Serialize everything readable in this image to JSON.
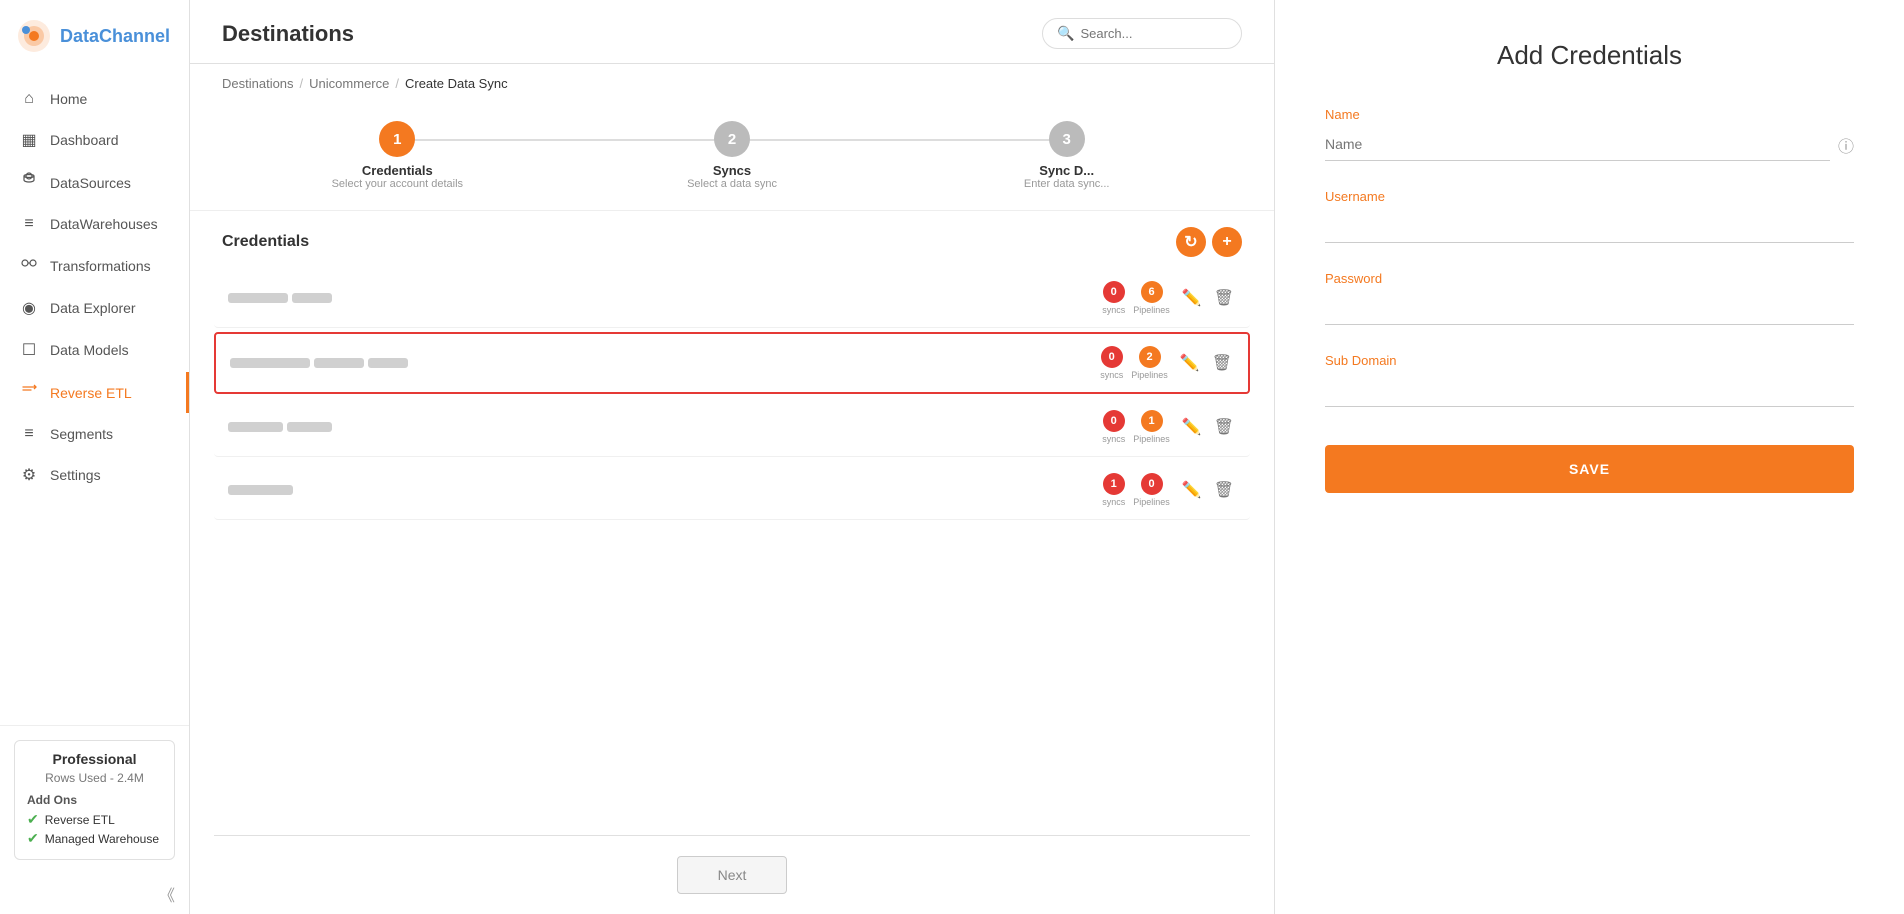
{
  "app": {
    "logo_data": "DC",
    "logo_brand": "DataChannel"
  },
  "sidebar": {
    "items": [
      {
        "id": "home",
        "label": "Home",
        "icon": "⌂",
        "active": false
      },
      {
        "id": "dashboard",
        "label": "Dashboard",
        "icon": "▦",
        "active": false
      },
      {
        "id": "datasources",
        "label": "DataSources",
        "icon": "⋯",
        "active": false
      },
      {
        "id": "datawarehouses",
        "label": "DataWarehouses",
        "icon": "≡",
        "active": false
      },
      {
        "id": "transformations",
        "label": "Transformations",
        "icon": "⟳",
        "active": false
      },
      {
        "id": "data-explorer",
        "label": "Data Explorer",
        "icon": "◉",
        "active": false
      },
      {
        "id": "data-models",
        "label": "Data Models",
        "icon": "☐",
        "active": false
      },
      {
        "id": "reverse-etl",
        "label": "Reverse ETL",
        "icon": "⇄",
        "active": true
      },
      {
        "id": "segments",
        "label": "Segments",
        "icon": "≡",
        "active": false
      },
      {
        "id": "settings",
        "label": "Settings",
        "icon": "⚙",
        "active": false
      }
    ]
  },
  "plan": {
    "name": "Professional",
    "rows_label": "Rows Used - 2.4M",
    "addons_title": "Add Ons",
    "addons": [
      {
        "label": "Reverse ETL"
      },
      {
        "label": "Managed Warehouse"
      }
    ]
  },
  "header": {
    "title": "Destinations",
    "search_placeholder": "Search..."
  },
  "breadcrumb": {
    "items": [
      "Destinations",
      "Unicommerce",
      "Create Data Sync"
    ]
  },
  "wizard": {
    "steps": [
      {
        "number": "1",
        "label": "Credentials",
        "sublabel": "Select your account details",
        "active": true
      },
      {
        "number": "2",
        "label": "Syncs",
        "sublabel": "Select a data sync",
        "active": false
      },
      {
        "number": "3",
        "label": "Sync D...",
        "sublabel": "Enter data sync...",
        "active": false
      }
    ]
  },
  "credentials_section": {
    "title": "Credentials",
    "refresh_btn": "↻",
    "add_btn": "+",
    "rows": [
      {
        "id": 1,
        "selected": false,
        "syncs": 0,
        "pipelines": 6,
        "widths": [
          60,
          40
        ]
      },
      {
        "id": 2,
        "selected": true,
        "syncs": 0,
        "pipelines": 2,
        "widths": [
          80,
          50,
          40
        ]
      },
      {
        "id": 3,
        "selected": false,
        "syncs": 0,
        "pipelines": 1,
        "widths": [
          55,
          45
        ]
      },
      {
        "id": 4,
        "selected": false,
        "syncs": 1,
        "pipelines": 0,
        "widths": [
          65,
          0
        ]
      }
    ]
  },
  "next_btn": "Next",
  "right_panel": {
    "title": "Add Credentials",
    "fields": [
      {
        "id": "name",
        "label": "Name",
        "placeholder": "Name",
        "type": "text",
        "show_info": true
      },
      {
        "id": "username",
        "label": "Username",
        "placeholder": "",
        "type": "text",
        "show_info": false
      },
      {
        "id": "password",
        "label": "Password",
        "placeholder": "",
        "type": "password",
        "show_info": false
      },
      {
        "id": "subdomain",
        "label": "Sub Domain",
        "placeholder": "",
        "type": "text",
        "show_info": false
      }
    ],
    "save_label": "SAVE"
  }
}
